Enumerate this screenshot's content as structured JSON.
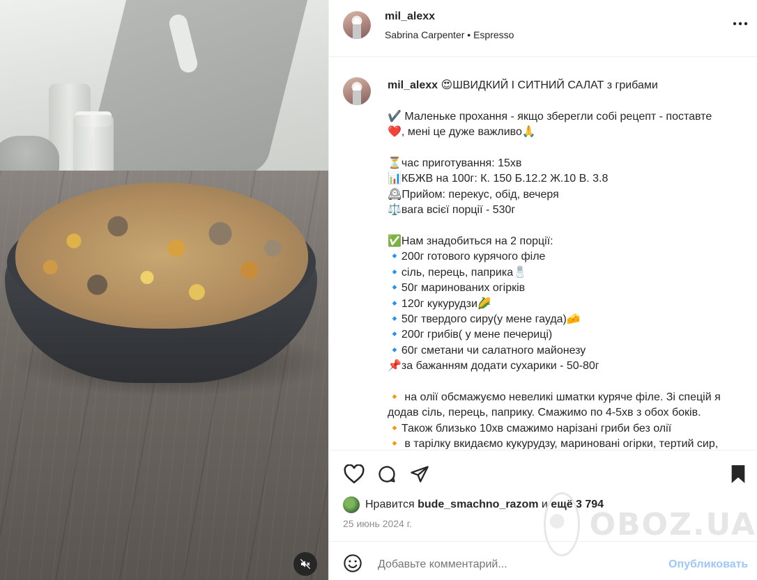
{
  "header": {
    "username": "mil_alexx",
    "music": "Sabrina Carpenter • Espresso"
  },
  "caption": {
    "username": "mil_alexx",
    "title": "😍ШВИДКИЙ І СИТНИЙ САЛАТ з грибами",
    "lines": [
      "✔️ Маленьке прохання - якщо зберегли собі рецепт - поставте",
      "❤️, мені це дуже важливо🙏",
      "",
      "⏳час приготування: 15хв",
      "📊КБЖВ на 100г: К. 150 Б.12.2 Ж.10 В. 3.8",
      "🕰Прийом: перекус, обід, вечеря",
      "⚖️вага всієї порції - 530г",
      "",
      "✅Нам знадобиться на 2 порції:",
      "🔹200г готового курячого філе",
      "🔹сіль, перець, паприка🧂",
      "🔹50г маринованих огірків",
      "🔹120г кукурудзи🌽",
      "🔹50г твердого сиру(у мене гауда)🧀",
      "🔹200г грибів( у мене печериці)",
      "🔹60г сметани чи салатного майонезу",
      "📌за бажанням додати сухарики - 50-80г",
      "",
      "🔸 на олії обсмажуємо невеликі шматки куряче філе. Зі спецій я",
      "додав сіль, перець, паприку. Смажимо по 4-5хв з обох боків.",
      "🔸Також близько 10хв смажимо нарізані гриби без олії",
      "🔸 в тарілку вкидаємо кукурудзу, мариновані огірки, тертий сир,"
    ]
  },
  "likes": {
    "prefix": "Нравится",
    "user": "bude_smachno_razom",
    "middle": "и",
    "count": "ещё 3 794"
  },
  "date": "25 июнь 2024 г.",
  "comment": {
    "placeholder": "Добавьте комментарий...",
    "publish": "Опубликовать"
  },
  "watermark": "OBOZ.UA"
}
